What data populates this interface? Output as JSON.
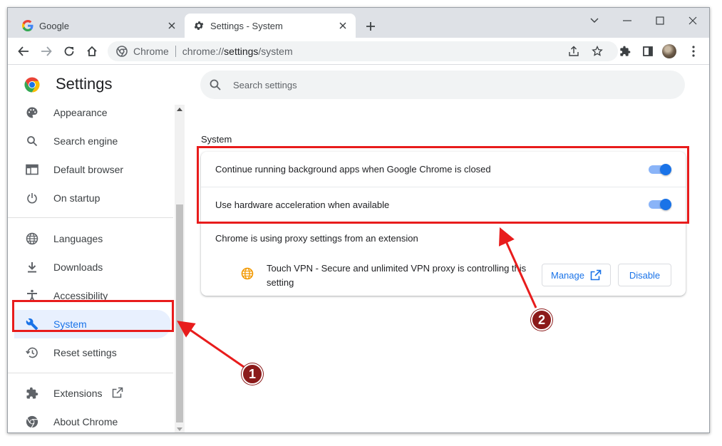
{
  "browser": {
    "tabs": [
      {
        "title": "Google",
        "active": false
      },
      {
        "title": "Settings - System",
        "active": true
      }
    ],
    "omnibox": {
      "site_label": "Chrome",
      "url_scheme": "chrome://",
      "url_path": "settings",
      "url_rest": "/system"
    }
  },
  "settings": {
    "title": "Settings",
    "search_placeholder": "Search settings",
    "nav": [
      {
        "label": "Appearance",
        "icon": "palette-icon"
      },
      {
        "label": "Search engine",
        "icon": "search-icon"
      },
      {
        "label": "Default browser",
        "icon": "browser-window-icon"
      },
      {
        "label": "On startup",
        "icon": "power-icon"
      },
      {
        "label": "Languages",
        "icon": "globe-icon"
      },
      {
        "label": "Downloads",
        "icon": "download-icon"
      },
      {
        "label": "Accessibility",
        "icon": "accessibility-icon"
      },
      {
        "label": "System",
        "icon": "wrench-icon",
        "selected": true
      },
      {
        "label": "Reset settings",
        "icon": "history-icon"
      },
      {
        "label": "Extensions",
        "icon": "puzzle-icon"
      },
      {
        "label": "About Chrome",
        "icon": "chrome-logo-icon"
      }
    ],
    "section_title": "System",
    "rows": [
      {
        "label": "Continue running background apps when Google Chrome is closed",
        "enabled": true
      },
      {
        "label": "Use hardware acceleration when available",
        "enabled": true
      }
    ],
    "proxy": {
      "heading": "Chrome is using proxy settings from an extension",
      "extension_text": "Touch VPN - Secure and unlimited VPN proxy is controlling this setting",
      "manage_label": "Manage",
      "disable_label": "Disable"
    }
  },
  "annotations": [
    {
      "number": "1"
    },
    {
      "number": "2"
    }
  ],
  "colors": {
    "accent": "#1a73e8",
    "annotation_red": "#e81c1c",
    "badge": "#8b1a1a"
  }
}
